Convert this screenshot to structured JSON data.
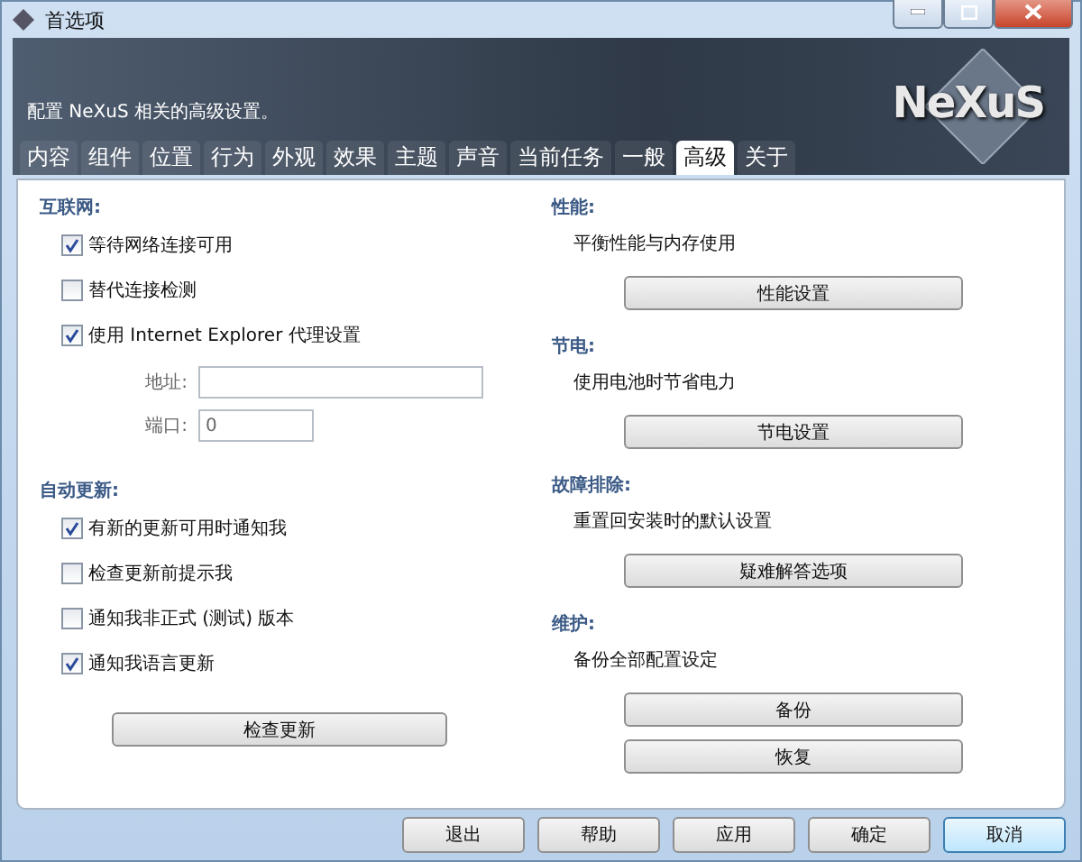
{
  "window": {
    "title": "首选项"
  },
  "banner": {
    "description": "配置 NeXuS 相关的高级设置。",
    "logo": "NeXuS"
  },
  "tabs": [
    {
      "label": "内容",
      "selected": false
    },
    {
      "label": "组件",
      "selected": false
    },
    {
      "label": "位置",
      "selected": false
    },
    {
      "label": "行为",
      "selected": false
    },
    {
      "label": "外观",
      "selected": false
    },
    {
      "label": "效果",
      "selected": false
    },
    {
      "label": "主题",
      "selected": false
    },
    {
      "label": "声音",
      "selected": false
    },
    {
      "label": "当前任务",
      "selected": false
    },
    {
      "label": "一般",
      "selected": false
    },
    {
      "label": "高级",
      "selected": true
    },
    {
      "label": "关于",
      "selected": false
    }
  ],
  "internet": {
    "heading": "互联网:",
    "options": [
      {
        "label": "等待网络连接可用",
        "checked": true
      },
      {
        "label": "替代连接检测",
        "checked": false
      },
      {
        "label": "使用 Internet Explorer 代理设置",
        "checked": true
      }
    ],
    "fields": [
      {
        "label": "地址:"
      },
      {
        "label": "端口:",
        "value": "0"
      }
    ]
  },
  "updates": {
    "heading": "自动更新:",
    "options": [
      {
        "label": "有新的更新可用时通知我",
        "checked": true
      },
      {
        "label": "检查更新前提示我",
        "checked": false
      },
      {
        "label": "通知我非正式 (测试) 版本",
        "checked": false
      },
      {
        "label": "通知我语言更新",
        "checked": true
      }
    ],
    "button": "检查更新"
  },
  "right_sections": [
    {
      "heading": "性能:",
      "text": "平衡性能与内存使用",
      "buttons": [
        "性能设置"
      ]
    },
    {
      "heading": "节电:",
      "text": "使用电池时节省电力",
      "buttons": [
        "节电设置"
      ]
    },
    {
      "heading": "故障排除:",
      "text": "重置回安装时的默认设置",
      "buttons": [
        "疑难解答选项"
      ]
    },
    {
      "heading": "维护:",
      "text": "备份全部配置设定",
      "buttons": [
        "备份",
        "恢复"
      ]
    }
  ],
  "footer_buttons": [
    {
      "label": "退出",
      "default": false
    },
    {
      "label": "帮助",
      "default": false
    },
    {
      "label": "应用",
      "default": false
    },
    {
      "label": "确定",
      "default": false
    },
    {
      "label": "取消",
      "default": true
    }
  ]
}
